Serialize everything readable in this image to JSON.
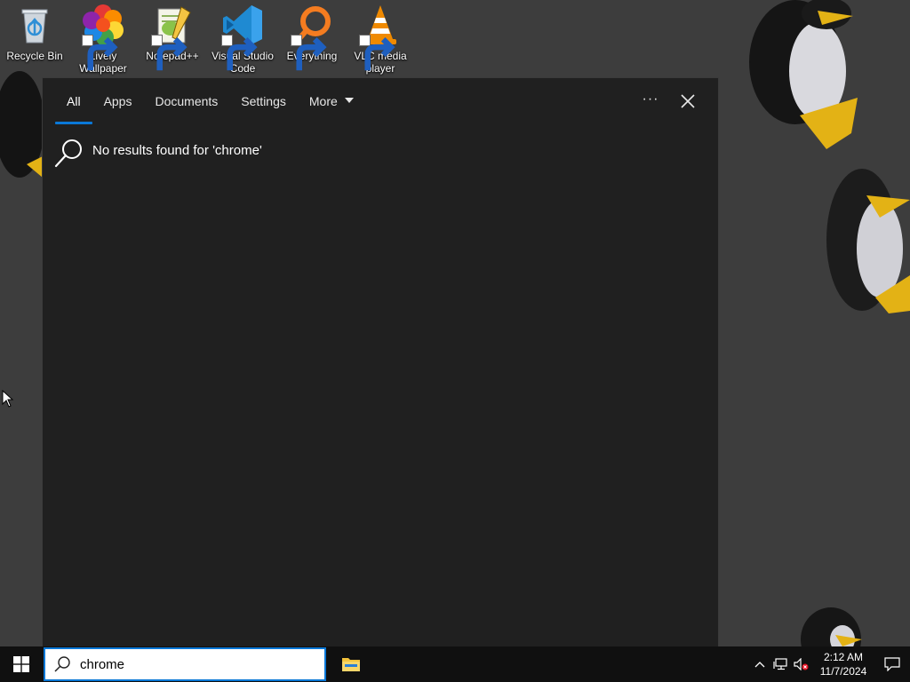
{
  "desktop": {
    "icons": [
      {
        "label": "Recycle Bin",
        "icon": "recycle-bin-icon"
      },
      {
        "label": "Lively Wallpaper",
        "icon": "lively-wallpaper-icon"
      },
      {
        "label": "Notepad++",
        "icon": "notepadpp-icon"
      },
      {
        "label": "Visual Studio Code",
        "icon": "vscode-icon"
      },
      {
        "label": "Everything",
        "icon": "everything-icon"
      },
      {
        "label": "VLC media player",
        "icon": "vlc-icon"
      }
    ]
  },
  "search_panel": {
    "tabs": [
      {
        "label": "All",
        "active": true
      },
      {
        "label": "Apps",
        "active": false
      },
      {
        "label": "Documents",
        "active": false
      },
      {
        "label": "Settings",
        "active": false
      },
      {
        "label": "More",
        "active": false
      }
    ],
    "ellipsis": "···",
    "no_results_message": "No results found for 'chrome'"
  },
  "taskbar": {
    "search_value": "chrome",
    "clock_time": "2:12 AM",
    "clock_date": "11/7/2024"
  },
  "colors": {
    "accent": "#0a78d7",
    "panel_bg": "#202020",
    "desktop_bg": "#3d3d3d",
    "taskbar_bg": "#101010"
  }
}
